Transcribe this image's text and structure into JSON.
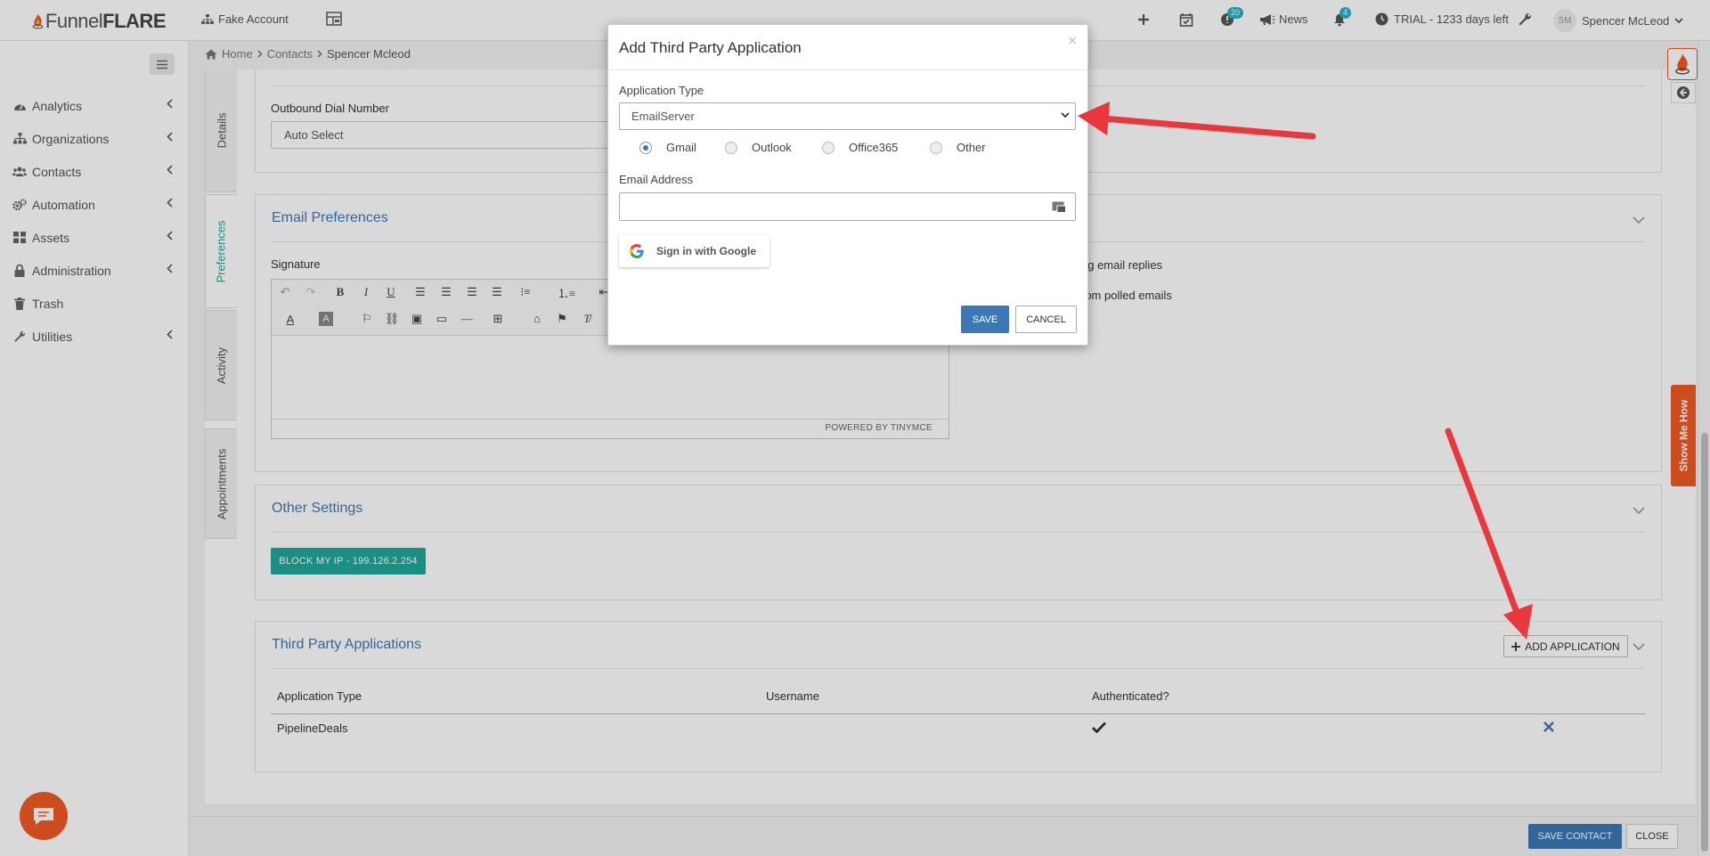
{
  "header": {
    "logo_text_plain": "Funnel",
    "logo_text_bold": "FLARE",
    "account_name": "Fake Account",
    "notifications_count": "20",
    "news_label": "News",
    "alerts_count": "4",
    "trial_label": "TRIAL - 1233 days left",
    "user_initials": "SM",
    "user_name": "Spencer McLeod"
  },
  "sidebar": {
    "items": [
      {
        "label": "Analytics",
        "icon": "dashboard-icon"
      },
      {
        "label": "Organizations",
        "icon": "sitemap-icon"
      },
      {
        "label": "Contacts",
        "icon": "users-icon"
      },
      {
        "label": "Automation",
        "icon": "cogs-icon"
      },
      {
        "label": "Assets",
        "icon": "grid-icon"
      },
      {
        "label": "Administration",
        "icon": "lock-icon"
      },
      {
        "label": "Trash",
        "icon": "trash-icon"
      },
      {
        "label": "Utilities",
        "icon": "wrench-icon"
      }
    ]
  },
  "breadcrumb": {
    "home": "Home",
    "contacts": "Contacts",
    "current": "Spencer Mcleod"
  },
  "vtabs": [
    "Details",
    "Preferences",
    "Activity",
    "Appointments"
  ],
  "details": {
    "outbound_label": "Outbound Dial Number",
    "outbound_value": "Auto Select"
  },
  "email_prefs": {
    "title": "Email Preferences",
    "signature_label": "Signature",
    "powered_by": "POWERED BY TINYMCE",
    "option_1_partial": "ng email replies",
    "option_2_partial": "rom polled emails"
  },
  "other_settings": {
    "title": "Other Settings",
    "block_ip_label": "BLOCK MY IP - 199.126.2.254"
  },
  "third_party": {
    "title": "Third Party Applications",
    "add_label": "ADD APPLICATION",
    "columns": [
      "Application Type",
      "Username",
      "Authenticated?"
    ],
    "rows": [
      {
        "type": "PipelineDeals",
        "username": "",
        "authenticated": true
      }
    ]
  },
  "footer": {
    "save_contact": "SAVE CONTACT",
    "close": "CLOSE"
  },
  "show_me_how": "Show Me How",
  "modal": {
    "title": "Add Third Party Application",
    "app_type_label": "Application Type",
    "app_type_value": "EmailServer",
    "radios": [
      {
        "label": "Gmail",
        "checked": true
      },
      {
        "label": "Outlook",
        "checked": false
      },
      {
        "label": "Office365",
        "checked": false
      },
      {
        "label": "Other",
        "checked": false
      }
    ],
    "email_label": "Email Address",
    "email_value": "",
    "google_label": "Sign in with Google",
    "save": "SAVE",
    "cancel": "CANCEL"
  },
  "colors": {
    "brand_orange": "#f15a24",
    "accent_blue": "#3b78b4",
    "teal": "#1fa99a",
    "annotation_red": "#e8383d"
  }
}
